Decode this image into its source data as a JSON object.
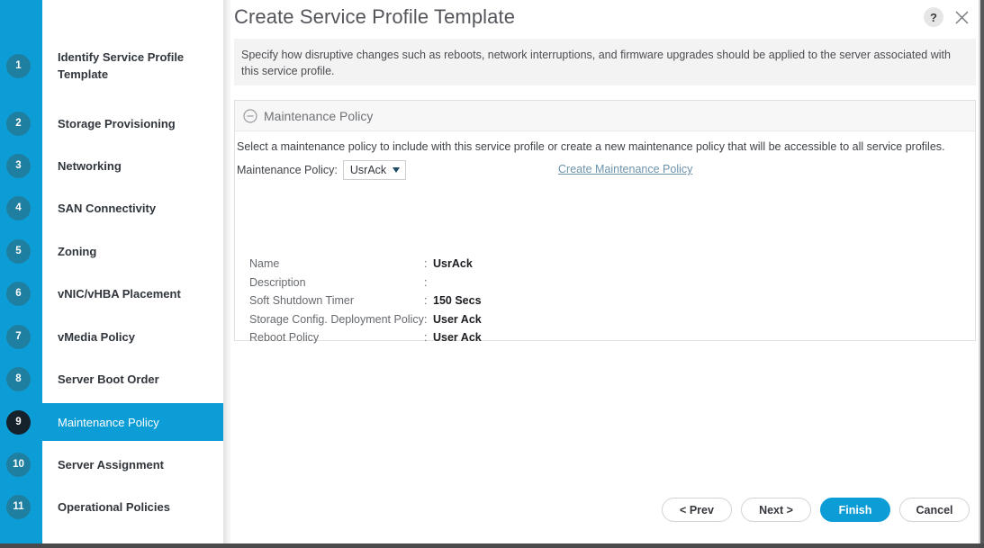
{
  "window": {
    "title": "Create Service Profile Template",
    "help_icon": "question-mark-icon",
    "close_icon": "close-icon",
    "help_label": "?"
  },
  "description": "Specify how disruptive changes such as reboots, network interruptions, and firmware upgrades should be applied to the server associated with this service profile.",
  "sidebar": {
    "items": [
      {
        "num": "1",
        "label": "Identify Service Profile Template",
        "active": false
      },
      {
        "num": "2",
        "label": "Storage Provisioning",
        "active": false
      },
      {
        "num": "3",
        "label": "Networking",
        "active": false
      },
      {
        "num": "4",
        "label": "SAN Connectivity",
        "active": false
      },
      {
        "num": "5",
        "label": "Zoning",
        "active": false
      },
      {
        "num": "6",
        "label": "vNIC/vHBA Placement",
        "active": false
      },
      {
        "num": "7",
        "label": "vMedia Policy",
        "active": false
      },
      {
        "num": "8",
        "label": "Server Boot Order",
        "active": false
      },
      {
        "num": "9",
        "label": "Maintenance Policy",
        "active": true
      },
      {
        "num": "10",
        "label": "Server Assignment",
        "active": false
      },
      {
        "num": "11",
        "label": "Operational Policies",
        "active": false
      }
    ]
  },
  "panel": {
    "collapse_icon": "circle-minus-icon",
    "title": "Maintenance Policy",
    "helper_text": "Select a maintenance policy to include with this service profile or create a new maintenance policy that will be accessible to all service profiles.",
    "select_label": "Maintenance Policy:",
    "select_value": "UsrAck",
    "select_options": [
      "UsrAck"
    ],
    "create_link": "Create Maintenance Policy",
    "details": [
      {
        "label": "Name",
        "value": "UsrAck"
      },
      {
        "label": "Description",
        "value": ""
      },
      {
        "label": "Soft Shutdown Timer",
        "value": "150 Secs"
      },
      {
        "label": "Storage Config. Deployment Policy",
        "value": "User Ack"
      },
      {
        "label": "Reboot Policy",
        "value": "User Ack"
      }
    ]
  },
  "footer": {
    "buttons": [
      {
        "label": "< Prev",
        "primary": false
      },
      {
        "label": "Next >",
        "primary": false
      },
      {
        "label": "Finish",
        "primary": true
      },
      {
        "label": "Cancel",
        "primary": false
      }
    ]
  },
  "colors": {
    "accent": "#0d9dd6",
    "step_circle": "#1f7fa0",
    "active_circle": "#15212b",
    "link": "#6c93ab",
    "panel_header": "#f7f7f8",
    "desc_bg": "#f3f3f4"
  }
}
